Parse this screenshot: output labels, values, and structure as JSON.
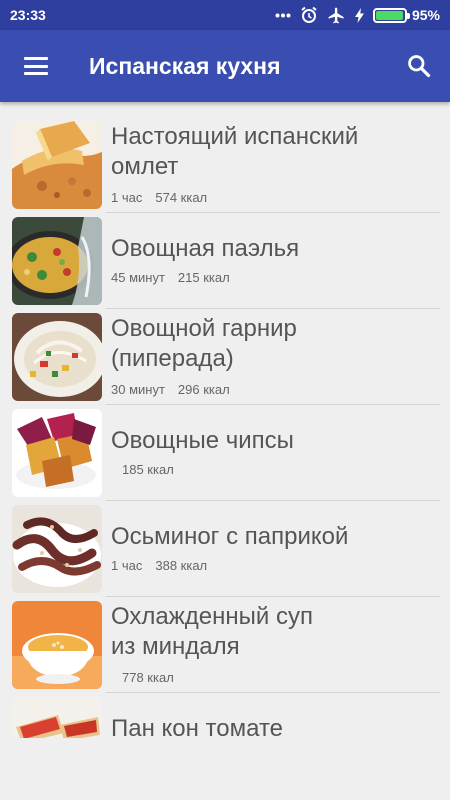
{
  "status_bar": {
    "time": "23:33",
    "battery_percent": "95%",
    "battery_level": 0.95,
    "icons": [
      "more-dots-icon",
      "alarm-icon",
      "airplane-icon",
      "charging-icon",
      "battery-icon"
    ]
  },
  "app_bar": {
    "title": "Испанская кухня",
    "menu_icon": "hamburger-icon",
    "search_icon": "search-icon"
  },
  "colors": {
    "status_bar": "#2f3f9f",
    "app_bar": "#3a4db0",
    "background": "#efefef",
    "battery_fill": "#4cd964"
  },
  "recipes": [
    {
      "title_line1": "Настоящий испанский",
      "title_line2": "омлет",
      "time": "1 час",
      "calories": "574 ккал"
    },
    {
      "title_line1": "Овощная паэлья",
      "time": "45 минут",
      "calories": "215 ккал"
    },
    {
      "title_line1": "Овощной гарнир",
      "title_line2": "(пиперада)",
      "time": "30 минут",
      "calories": "296 ккал"
    },
    {
      "title_line1": "Овощные чипсы",
      "calories": "185 ккал"
    },
    {
      "title_line1": "Осьминог с паприкой",
      "time": "1 час",
      "calories": "388 ккал"
    },
    {
      "title_line1": "Охлажденный суп",
      "title_line2": "из миндаля",
      "calories": "778 ккал"
    },
    {
      "title_line1": "Пан кон томате"
    }
  ]
}
